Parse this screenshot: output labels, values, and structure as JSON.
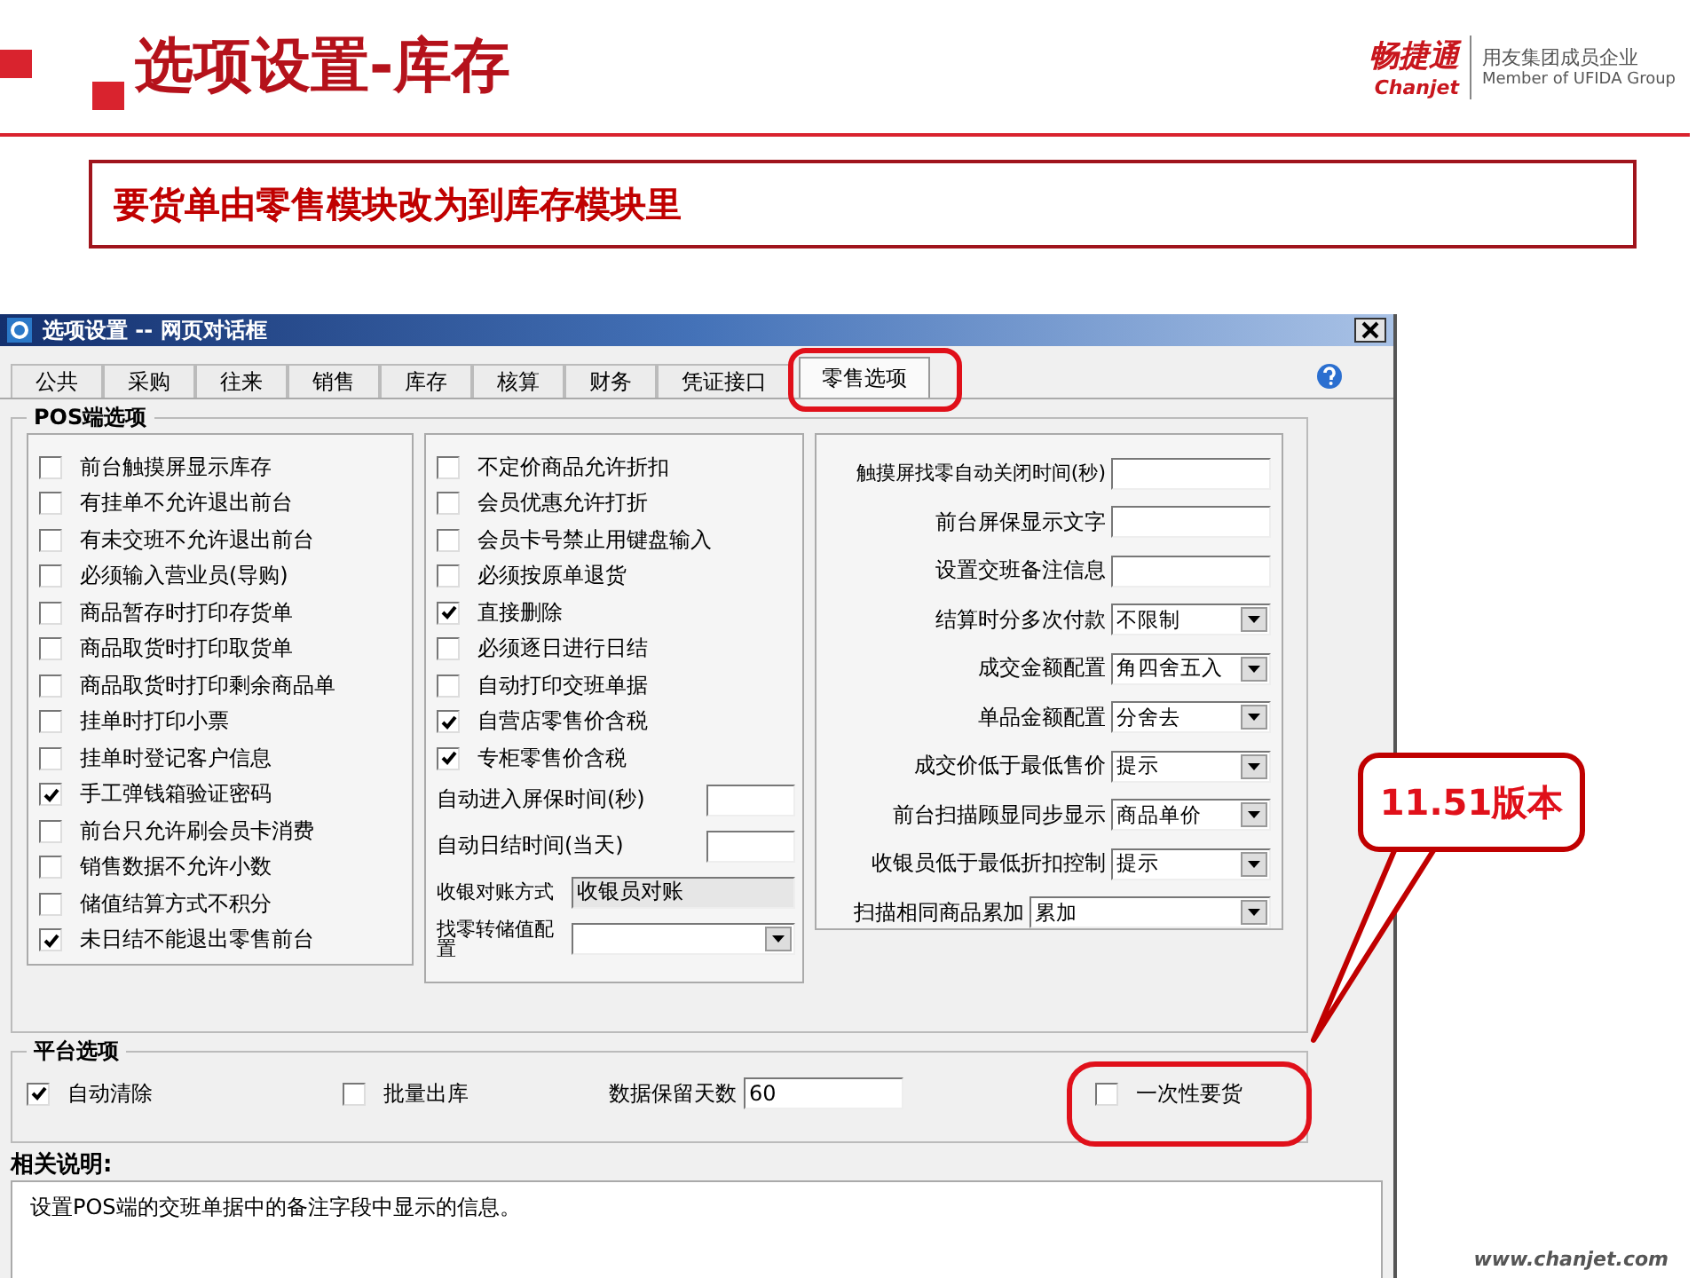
{
  "slide": {
    "title": "选项设置-库存",
    "subtitle": "要货单由零售模块改为到库存模块里",
    "logo": {
      "name": "畅捷通",
      "latin": "Chanjet",
      "tagline": "用友集团成员企业",
      "tagline_en": "Member of UFIDA Group"
    },
    "footer": "www.chanjet.com"
  },
  "window": {
    "title": "选项设置 -- 网页对话框"
  },
  "tabs": [
    {
      "label": "公共",
      "selected": false
    },
    {
      "label": "采购",
      "selected": false
    },
    {
      "label": "往来",
      "selected": false
    },
    {
      "label": "销售",
      "selected": false
    },
    {
      "label": "库存",
      "selected": false
    },
    {
      "label": "核算",
      "selected": false
    },
    {
      "label": "财务",
      "selected": false
    },
    {
      "label": "凭证接口",
      "selected": false
    },
    {
      "label": "零售选项",
      "selected": true
    }
  ],
  "pos_group": {
    "title": "POS端选项",
    "left_options": [
      {
        "label": "前台触摸屏显示库存",
        "checked": false
      },
      {
        "label": "有挂单不允许退出前台",
        "checked": false
      },
      {
        "label": "有未交班不允许退出前台",
        "checked": false
      },
      {
        "label": "必须输入营业员(导购)",
        "checked": false
      },
      {
        "label": "商品暂存时打印存货单",
        "checked": false
      },
      {
        "label": "商品取货时打印取货单",
        "checked": false
      },
      {
        "label": "商品取货时打印剩余商品单",
        "checked": false
      },
      {
        "label": "挂单时打印小票",
        "checked": false
      },
      {
        "label": "挂单时登记客户信息",
        "checked": false
      },
      {
        "label": "手工弹钱箱验证密码",
        "checked": true
      },
      {
        "label": "前台只允许刷会员卡消费",
        "checked": false
      },
      {
        "label": "销售数据不允许小数",
        "checked": false
      },
      {
        "label": "储值结算方式不积分",
        "checked": false
      },
      {
        "label": "未日结不能退出零售前台",
        "checked": true
      }
    ],
    "middle_options": [
      {
        "label": "不定价商品允许折扣",
        "checked": false
      },
      {
        "label": "会员优惠允许打折",
        "checked": false
      },
      {
        "label": "会员卡号禁止用键盘输入",
        "checked": false
      },
      {
        "label": "必须按原单退货",
        "checked": false
      },
      {
        "label": "直接删除",
        "checked": true
      },
      {
        "label": "必须逐日进行日结",
        "checked": false
      },
      {
        "label": "自动打印交班单据",
        "checked": false
      },
      {
        "label": "自营店零售价含税",
        "checked": true
      },
      {
        "label": "专柜零售价含税",
        "checked": true
      }
    ],
    "middle_fields": [
      {
        "label": "自动进入屏保时间(秒)",
        "kind": "text"
      },
      {
        "label": "自动日结时间(当天)",
        "kind": "text"
      },
      {
        "label": "收银对账方式",
        "kind": "readonly",
        "value": "收银员对账"
      },
      {
        "label": "找零转储值配置",
        "kind": "select"
      }
    ],
    "right_fields": [
      {
        "label": "触摸屏找零自动关闭时间(秒)",
        "kind": "text"
      },
      {
        "label": "前台屏保显示文字",
        "kind": "text"
      },
      {
        "label": "设置交班备注信息",
        "kind": "text"
      },
      {
        "label": "结算时分多次付款",
        "kind": "select",
        "value": "不限制"
      },
      {
        "label": "成交金额配置",
        "kind": "select",
        "value": "角四舍五入"
      },
      {
        "label": "单品金额配置",
        "kind": "select",
        "value": "分舍去"
      },
      {
        "label": "成交价低于最低售价",
        "kind": "select",
        "value": "提示"
      },
      {
        "label": "前台扫描顾显同步显示",
        "kind": "select",
        "value": "商品单价"
      },
      {
        "label": "收银员低于最低折扣控制",
        "kind": "select",
        "value": "提示"
      },
      {
        "label": "扫描相同商品累加",
        "kind": "wide-select",
        "value": "累加"
      }
    ]
  },
  "platform_group": {
    "title": "平台选项",
    "options": [
      {
        "label": "自动清除",
        "checked": true
      },
      {
        "label": "批量出库",
        "checked": false
      }
    ],
    "retention": {
      "label": "数据保留天数",
      "value": "60"
    },
    "once_request": {
      "label": "一次性要货",
      "checked": false
    }
  },
  "notes": {
    "title": "相关说明:",
    "text": "设置POS端的交班单据中的备注字段中显示的信息。"
  },
  "callout": {
    "text": "11.51版本"
  }
}
